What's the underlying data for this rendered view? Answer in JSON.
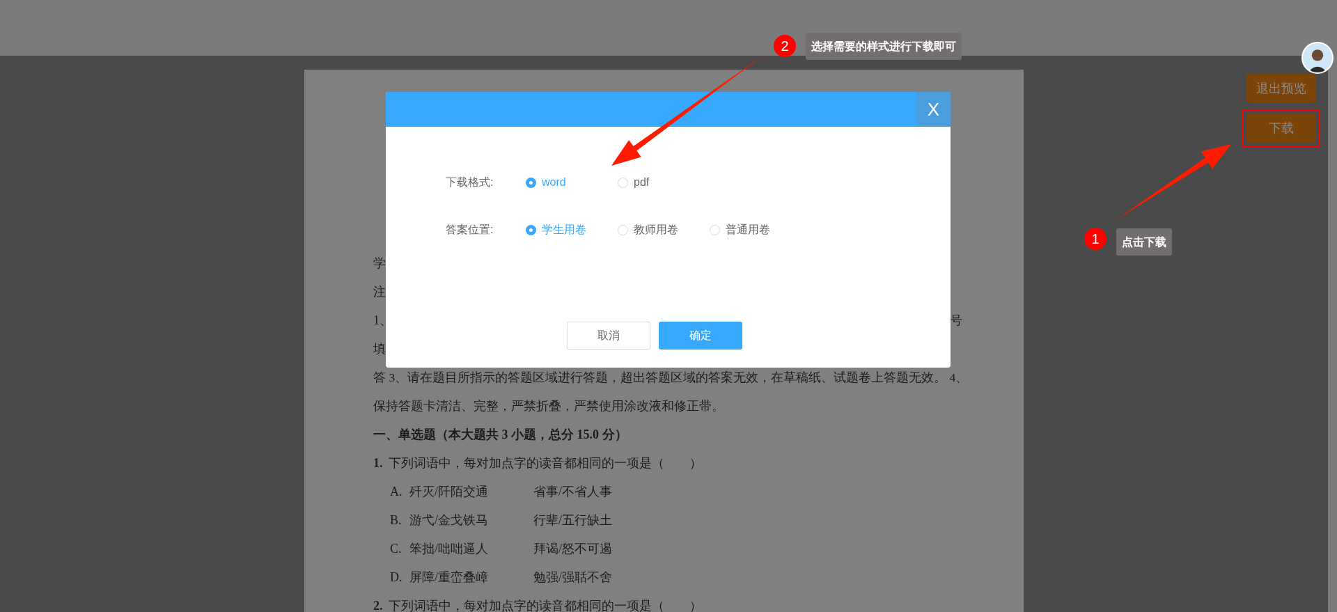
{
  "document": {
    "lines": [
      {
        "kind": "clipped",
        "text": "学"
      },
      {
        "kind": "clipped",
        "text": "注"
      },
      {
        "kind": "clipped",
        "text": "1、",
        "end": "号"
      },
      {
        "kind": "clipped",
        "text": "填"
      },
      {
        "kind": "body",
        "text": "答 3、请在题目所指示的答题区域进行答题，超出答题区域的答案无效，在草稿纸、试题卷上答题无效。 4、"
      },
      {
        "kind": "body",
        "text": "保持答题卡清洁、完整，严禁折叠，严禁使用涂改液和修正带。"
      },
      {
        "kind": "heading",
        "text": "一、单选题（本大题共 3 小题，总分 15.0 分）"
      },
      {
        "kind": "question",
        "number": "1.",
        "text": "下列词语中，每对加点字的读音都相同的一项是（　　）"
      },
      {
        "kind": "option",
        "letter": "A.",
        "first": "歼灭/阡陌交通",
        "second": "省事/不省人事"
      },
      {
        "kind": "option",
        "letter": "B.",
        "first": "游弋/金戈铁马",
        "second": "行辈/五行缺土"
      },
      {
        "kind": "option",
        "letter": "C.",
        "first": "笨拙/咄咄逼人",
        "second": "拜谒/怒不可遏"
      },
      {
        "kind": "option",
        "letter": "D.",
        "first": "屏障/重峦叠嶂",
        "second": "勉强/强聒不舍"
      },
      {
        "kind": "question",
        "number": "2.",
        "text": "下列词语中，每对加点字的读音都相同的一项是（　　）"
      }
    ]
  },
  "toolbar": {
    "buttons": [
      {
        "label": "退出预览",
        "highlighted": false
      },
      {
        "label": "下载",
        "highlighted": true
      }
    ]
  },
  "dialog": {
    "close": "X",
    "fields": [
      {
        "label": "下载格式:",
        "options": [
          {
            "label": "word",
            "selected": true
          },
          {
            "label": "pdf",
            "selected": false
          }
        ]
      },
      {
        "label": "答案位置:",
        "options": [
          {
            "label": "学生用卷",
            "selected": true
          },
          {
            "label": "教师用卷",
            "selected": false
          },
          {
            "label": "普通用卷",
            "selected": false
          }
        ]
      }
    ],
    "buttons": [
      {
        "label": "取消",
        "kind": "secondary"
      },
      {
        "label": "确定",
        "kind": "primary"
      }
    ]
  },
  "annotations": [
    {
      "number": "1",
      "text": "点击下载"
    },
    {
      "number": "2",
      "text": "选择需要的样式进行下载即可"
    }
  ]
}
